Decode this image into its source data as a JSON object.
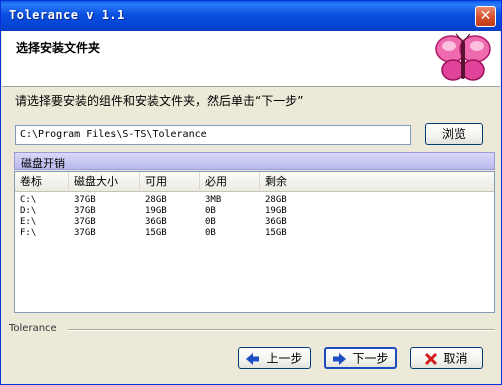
{
  "window": {
    "title": "Tolerance v 1.1",
    "close_glyph": "✕"
  },
  "header": {
    "title": "选择安装文件夹",
    "logo_icon": "butterfly-icon"
  },
  "instruction": "请选择要安装的组件和安装文件夹，然后单击“下一步”",
  "install_path": {
    "value": "C:\\Program Files\\S-TS\\Tolerance"
  },
  "browse_label": "浏览",
  "disk_space": {
    "label": "磁盘开销",
    "columns": [
      "卷标",
      "磁盘大小",
      "可用",
      "必用",
      "剩余"
    ],
    "rows": [
      [
        "C:\\",
        "37GB",
        "28GB",
        "3MB",
        "28GB"
      ],
      [
        "D:\\",
        "37GB",
        "19GB",
        "0B",
        "19GB"
      ],
      [
        "E:\\",
        "37GB",
        "36GB",
        "0B",
        "36GB"
      ],
      [
        "F:\\",
        "37GB",
        "15GB",
        "0B",
        "15GB"
      ]
    ]
  },
  "footer": {
    "brand": "Tolerance",
    "back_label": "上一步",
    "next_label": "下一步",
    "cancel_label": "取消"
  },
  "colors": {
    "titlebar": "#0a4fe0",
    "dialog_bg": "#ece9d8",
    "group_header": "#c8c8f2",
    "cancel_x": "#d42020",
    "arrow": "#1c4fc4"
  }
}
